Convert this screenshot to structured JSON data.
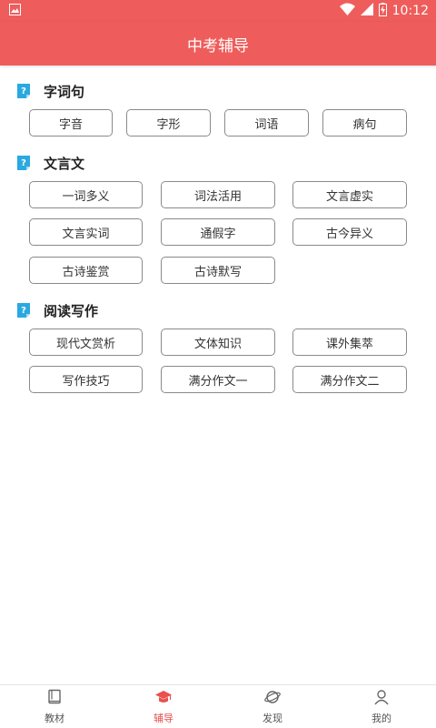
{
  "status_bar": {
    "time": "10:12",
    "icons": [
      "image-icon",
      "wifi-icon",
      "signal-icon",
      "battery-charging-icon"
    ]
  },
  "header": {
    "title": "中考辅导"
  },
  "sections": [
    {
      "title": "字词句",
      "items": [
        "字音",
        "字形",
        "词语",
        "病句"
      ]
    },
    {
      "title": "文言文",
      "items": [
        "一词多义",
        "词法活用",
        "文言虚实",
        "文言实词",
        "通假字",
        "古今异义",
        "古诗鉴赏",
        "古诗默写"
      ]
    },
    {
      "title": "阅读写作",
      "items": [
        "现代文赏析",
        "文体知识",
        "课外集萃",
        "写作技巧",
        "满分作文一",
        "满分作文二"
      ]
    }
  ],
  "tabs": [
    {
      "label": "教材",
      "icon": "book-icon"
    },
    {
      "label": "辅导",
      "icon": "graduation-cap-icon",
      "active": true
    },
    {
      "label": "发现",
      "icon": "planet-icon"
    },
    {
      "label": "我的",
      "icon": "user-icon"
    }
  ],
  "colors": {
    "primary": "#ee5d5b",
    "tab_active": "#e9504e",
    "section_icon": "#29a9e1"
  }
}
